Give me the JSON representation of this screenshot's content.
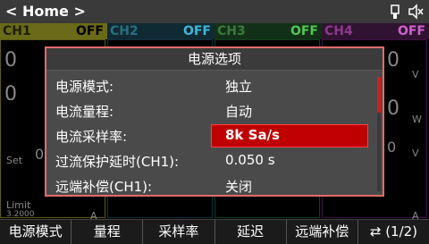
{
  "header": {
    "title": "< Home >"
  },
  "channels": [
    {
      "name": "CH1",
      "state": "OFF"
    },
    {
      "name": "CH2",
      "state": "OFF"
    },
    {
      "name": "CH3",
      "state": "OFF"
    },
    {
      "name": "CH4",
      "state": "OFF"
    }
  ],
  "background": {
    "ch1_big1": "0",
    "ch1_big2": "0",
    "ch1_set": "Set",
    "ch1_set_val": "0",
    "ch1_limit": "Limit",
    "ch1_limit_val": "3.2000",
    "ch1_unit": "A",
    "ch4_unit_v1": "V",
    "ch4_unit_w": "W",
    "ch4_unit_v2": "V",
    "ch4_unit_a": "A",
    "ch4_big1": "0",
    "ch4_big2": "0",
    "ch4_big3": "0"
  },
  "dialog": {
    "title": "电源选项",
    "rows": [
      {
        "label": "电源模式:",
        "value": "独立"
      },
      {
        "label": "电流量程:",
        "value": "自动"
      },
      {
        "label": "电流采样率:",
        "value": "8k Sa/s"
      },
      {
        "label": "过流保护延时(CH1):",
        "value": "0.050  s"
      },
      {
        "label": "远端补偿(CH1):",
        "value": "关闭"
      }
    ]
  },
  "bottom_tabs": [
    "电源模式",
    "量程",
    "采样率",
    "延迟",
    "远端补偿",
    "(1/2)"
  ],
  "colors": {
    "accent_red": "#c00000",
    "dialog_border": "#e56b6b"
  }
}
